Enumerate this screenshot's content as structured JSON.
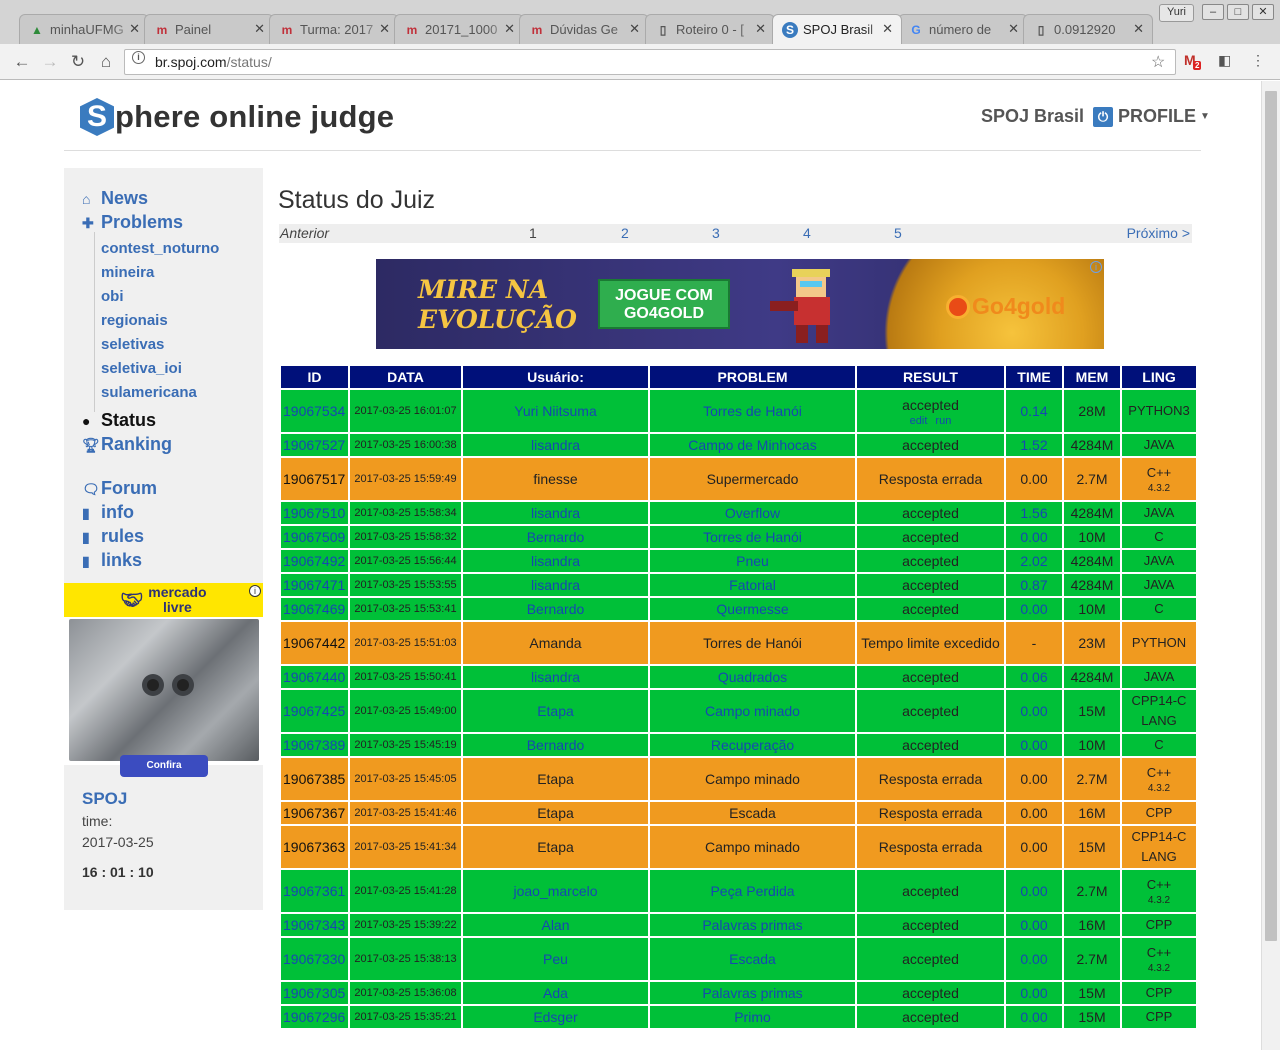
{
  "browser": {
    "tabs": [
      {
        "title": "minhaUFMG",
        "icon": "ufmg-icon",
        "active": false
      },
      {
        "title": "Painel",
        "icon": "moodle-icon",
        "active": false
      },
      {
        "title": "Turma: 2017",
        "icon": "moodle-icon",
        "active": false
      },
      {
        "title": "20171_1000",
        "icon": "moodle-icon",
        "active": false
      },
      {
        "title": "Dúvidas Ge",
        "icon": "moodle-icon",
        "active": false
      },
      {
        "title": "Roteiro 0 - [",
        "icon": "document-icon",
        "active": false
      },
      {
        "title": "SPOJ Brasil",
        "icon": "spoj-icon",
        "active": true
      },
      {
        "title": "número de",
        "icon": "google-icon",
        "active": false
      },
      {
        "title": "0.0912920",
        "icon": "document-icon",
        "active": false
      }
    ],
    "user": "Yuri",
    "url_host": "br.spoj.com",
    "url_path": "/status/",
    "gmail_badge": "2"
  },
  "header": {
    "logo_letter": "S",
    "logo_text": "phere online judge",
    "site_name": "SPOJ Brasil",
    "profile_label": "PROFILE"
  },
  "sidebar": {
    "nav": [
      {
        "label": "News",
        "icon": "home-icon"
      },
      {
        "label": "Problems",
        "icon": "puzzle-icon"
      }
    ],
    "problem_sets": [
      "contest_noturno",
      "mineira",
      "obi",
      "regionais",
      "seletivas",
      "seletiva_ioi",
      "sulamericana"
    ],
    "status_label": "Status",
    "ranking_label": "Ranking",
    "links": [
      {
        "label": "Forum",
        "icon": "comment-icon"
      },
      {
        "label": "info",
        "icon": "file-icon"
      },
      {
        "label": "rules",
        "icon": "file-icon"
      },
      {
        "label": "links",
        "icon": "file-icon"
      }
    ],
    "ad": {
      "brand_line1": "mercado",
      "brand_line2": "livre",
      "button": "Confira"
    },
    "clock": {
      "title": "SPOJ",
      "label": "time:",
      "date": "2017-03-25",
      "time": "16 : 01 : 10"
    }
  },
  "main": {
    "title": "Status do Juiz",
    "pager": {
      "prev": "Anterior",
      "pages": [
        "1",
        "2",
        "3",
        "4",
        "5"
      ],
      "current": "1",
      "next": "Próximo >"
    },
    "ad": {
      "headline_1": "MIRE NA",
      "headline_2": "EVOLUÇÃO",
      "cta_1": "JOGUE COM",
      "cta_2": "GO4GOLD",
      "brand": "Go4gold"
    }
  },
  "table": {
    "headers": [
      "ID",
      "DATA",
      "Usuário:",
      "PROBLEM",
      "RESULT",
      "TIME",
      "MEM",
      "LING"
    ],
    "rows": [
      {
        "id": "19067534",
        "date": "2017-03-25 16:01:07",
        "user": "Yuri Niitsuma",
        "problem": "Torres de Hanói",
        "result": "accepted",
        "result_links": [
          "edit",
          "run"
        ],
        "time": "0.14",
        "mem": "28M",
        "lang": "PYTHON3",
        "lang_ver": "",
        "status": "ok",
        "tall": true
      },
      {
        "id": "19067527",
        "date": "2017-03-25 16:00:38",
        "user": "lisandra",
        "problem": "Campo de Minhocas",
        "result": "accepted",
        "time": "1.52",
        "mem": "4284M",
        "lang": "JAVA",
        "lang_ver": "",
        "status": "ok"
      },
      {
        "id": "19067517",
        "date": "2017-03-25 15:59:49",
        "user": "finesse",
        "problem": "Supermercado",
        "result": "Resposta errada",
        "time": "0.00",
        "mem": "2.7M",
        "lang": "C++",
        "lang_ver": "4.3.2",
        "status": "bad",
        "tall": true
      },
      {
        "id": "19067510",
        "date": "2017-03-25 15:58:34",
        "user": "lisandra",
        "problem": "Overflow",
        "result": "accepted",
        "time": "1.56",
        "mem": "4284M",
        "lang": "JAVA",
        "lang_ver": "",
        "status": "ok"
      },
      {
        "id": "19067509",
        "date": "2017-03-25 15:58:32",
        "user": "Bernardo",
        "problem": "Torres de Hanói",
        "result": "accepted",
        "time": "0.00",
        "mem": "10M",
        "lang": "C",
        "lang_ver": "",
        "status": "ok"
      },
      {
        "id": "19067492",
        "date": "2017-03-25 15:56:44",
        "user": "lisandra",
        "problem": "Pneu",
        "result": "accepted",
        "time": "2.02",
        "mem": "4284M",
        "lang": "JAVA",
        "lang_ver": "",
        "status": "ok"
      },
      {
        "id": "19067471",
        "date": "2017-03-25 15:53:55",
        "user": "lisandra",
        "problem": "Fatorial",
        "result": "accepted",
        "time": "0.87",
        "mem": "4284M",
        "lang": "JAVA",
        "lang_ver": "",
        "status": "ok"
      },
      {
        "id": "19067469",
        "date": "2017-03-25 15:53:41",
        "user": "Bernardo",
        "problem": "Quermesse",
        "result": "accepted",
        "time": "0.00",
        "mem": "10M",
        "lang": "C",
        "lang_ver": "",
        "status": "ok"
      },
      {
        "id": "19067442",
        "date": "2017-03-25 15:51:03",
        "user": "Amanda",
        "problem": "Torres de Hanói",
        "result": "Tempo limite excedido",
        "time": "-",
        "mem": "23M",
        "lang": "PYTHON",
        "lang_ver": "",
        "status": "bad",
        "tall": true
      },
      {
        "id": "19067440",
        "date": "2017-03-25 15:50:41",
        "user": "lisandra",
        "problem": "Quadrados",
        "result": "accepted",
        "time": "0.06",
        "mem": "4284M",
        "lang": "JAVA",
        "lang_ver": "",
        "status": "ok"
      },
      {
        "id": "19067425",
        "date": "2017-03-25 15:49:00",
        "user": "Etapa",
        "problem": "Campo minado",
        "result": "accepted",
        "time": "0.00",
        "mem": "15M",
        "lang": "CPP14-CLANG",
        "lang_ver": "",
        "status": "ok",
        "tall": true
      },
      {
        "id": "19067389",
        "date": "2017-03-25 15:45:19",
        "user": "Bernardo",
        "problem": "Recuperação",
        "result": "accepted",
        "time": "0.00",
        "mem": "10M",
        "lang": "C",
        "lang_ver": "",
        "status": "ok"
      },
      {
        "id": "19067385",
        "date": "2017-03-25 15:45:05",
        "user": "Etapa",
        "problem": "Campo minado",
        "result": "Resposta errada",
        "time": "0.00",
        "mem": "2.7M",
        "lang": "C++",
        "lang_ver": "4.3.2",
        "status": "bad",
        "tall": true
      },
      {
        "id": "19067367",
        "date": "2017-03-25 15:41:46",
        "user": "Etapa",
        "problem": "Escada",
        "result": "Resposta errada",
        "time": "0.00",
        "mem": "16M",
        "lang": "CPP",
        "lang_ver": "",
        "status": "bad"
      },
      {
        "id": "19067363",
        "date": "2017-03-25 15:41:34",
        "user": "Etapa",
        "problem": "Campo minado",
        "result": "Resposta errada",
        "time": "0.00",
        "mem": "15M",
        "lang": "CPP14-CLANG",
        "lang_ver": "",
        "status": "bad",
        "tall": true
      },
      {
        "id": "19067361",
        "date": "2017-03-25 15:41:28",
        "user": "joao_marcelo",
        "problem": "Peça Perdida",
        "result": "accepted",
        "time": "0.00",
        "mem": "2.7M",
        "lang": "C++",
        "lang_ver": "4.3.2",
        "status": "ok",
        "tall": true
      },
      {
        "id": "19067343",
        "date": "2017-03-25 15:39:22",
        "user": "Alan",
        "problem": "Palavras primas",
        "result": "accepted",
        "time": "0.00",
        "mem": "16M",
        "lang": "CPP",
        "lang_ver": "",
        "status": "ok"
      },
      {
        "id": "19067330",
        "date": "2017-03-25 15:38:13",
        "user": "Peu",
        "problem": "Escada",
        "result": "accepted",
        "time": "0.00",
        "mem": "2.7M",
        "lang": "C++",
        "lang_ver": "4.3.2",
        "status": "ok",
        "tall": true
      },
      {
        "id": "19067305",
        "date": "2017-03-25 15:36:08",
        "user": "Ada",
        "problem": "Palavras primas",
        "result": "accepted",
        "time": "0.00",
        "mem": "15M",
        "lang": "CPP",
        "lang_ver": "",
        "status": "ok"
      },
      {
        "id": "19067296",
        "date": "2017-03-25 15:35:21",
        "user": "Edsger",
        "problem": "Primo",
        "result": "accepted",
        "time": "0.00",
        "mem": "15M",
        "lang": "CPP",
        "lang_ver": "",
        "status": "ok"
      }
    ]
  },
  "colors": {
    "accepted": "#00c038",
    "error": "#f09a1f",
    "header": "#00107a",
    "link": "#3a6db5"
  }
}
